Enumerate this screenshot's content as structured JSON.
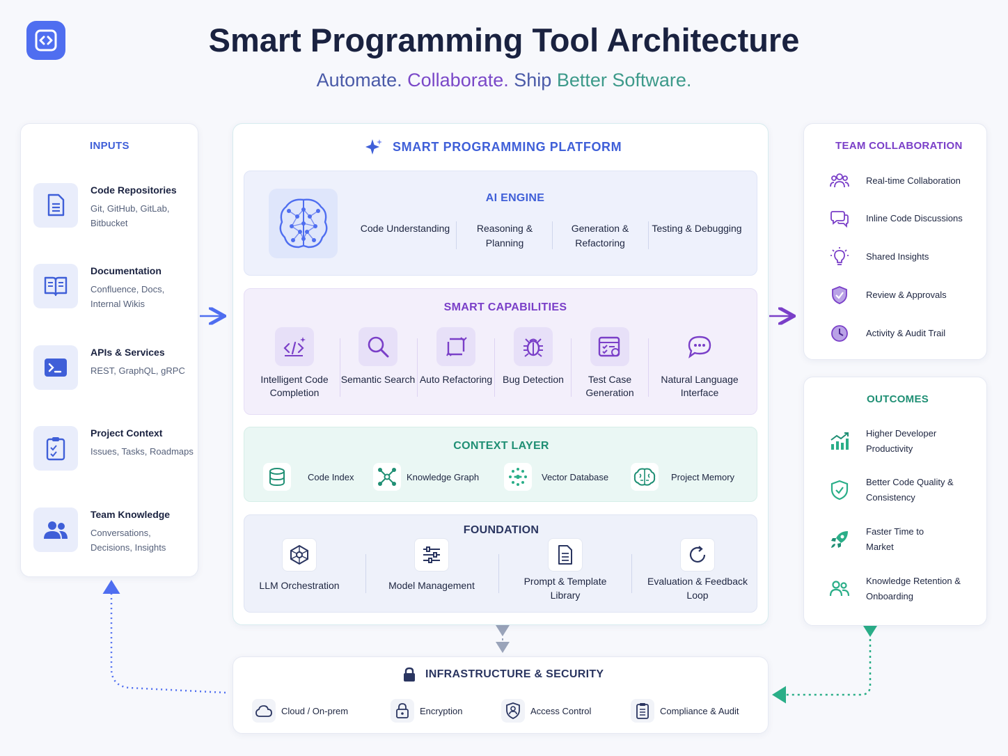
{
  "header": {
    "title": "Smart Programming Tool Architecture",
    "subtitle_1": "Automate.",
    "subtitle_2": "Collaborate.",
    "subtitle_3": "Ship",
    "subtitle_4": "Better Software."
  },
  "inputs": {
    "title": "INPUTS",
    "items": [
      {
        "name": "Code Repositories",
        "desc": "Git, GitHub, GitLab, Bitbucket",
        "icon": "document-icon"
      },
      {
        "name": "Documentation",
        "desc": "Confluence, Docs, Internal Wikis",
        "icon": "book-icon"
      },
      {
        "name": "APIs & Services",
        "desc": "REST, GraphQL, gRPC",
        "icon": "terminal-icon"
      },
      {
        "name": "Project Context",
        "desc": "Issues, Tasks, Roadmaps",
        "icon": "clipboard-icon"
      },
      {
        "name": "Team Knowledge",
        "desc": "Conversations, Decisions, Insights",
        "icon": "users-icon"
      }
    ]
  },
  "platform": {
    "title": "SMART PROGRAMMING PLATFORM",
    "ai_engine": {
      "title": "AI ENGINE",
      "items": [
        "Code Understanding",
        "Reasoning & Planning",
        "Generation & Refactoring",
        "Testing & Debugging"
      ]
    },
    "capabilities": {
      "title": "SMART CAPABILITIES",
      "items": [
        {
          "label": "Intelligent Code Completion",
          "icon": "code-sparkle-icon"
        },
        {
          "label": "Semantic Search",
          "icon": "search-icon"
        },
        {
          "label": "Auto Refactoring",
          "icon": "refactor-icon"
        },
        {
          "label": "Bug Detection",
          "icon": "bug-icon"
        },
        {
          "label": "Test Case Generation",
          "icon": "test-window-icon"
        },
        {
          "label": "Natural Language Interface",
          "icon": "chat-icon"
        }
      ]
    },
    "context": {
      "title": "CONTEXT LAYER",
      "items": [
        {
          "label": "Code Index",
          "icon": "database-icon"
        },
        {
          "label": "Knowledge Graph",
          "icon": "graph-icon"
        },
        {
          "label": "Vector Database",
          "icon": "vector-icon"
        },
        {
          "label": "Project Memory",
          "icon": "brain-icon"
        }
      ]
    },
    "foundation": {
      "title": "FOUNDATION",
      "items": [
        {
          "label": "LLM Orchestration",
          "icon": "network-icon"
        },
        {
          "label": "Model Management",
          "icon": "sliders-icon"
        },
        {
          "label": "Prompt & Template Library",
          "icon": "file-icon"
        },
        {
          "label": "Evaluation & Feedback Loop",
          "icon": "refresh-icon"
        }
      ]
    }
  },
  "team": {
    "title": "TEAM COLLABORATION",
    "items": [
      {
        "label": "Real-time Collaboration",
        "icon": "people-icon"
      },
      {
        "label": "Inline Code Discussions",
        "icon": "comments-icon"
      },
      {
        "label": "Shared Insights",
        "icon": "lightbulb-icon"
      },
      {
        "label": "Review & Approvals",
        "icon": "shield-check-icon"
      },
      {
        "label": "Activity & Audit Trail",
        "icon": "clock-icon"
      }
    ]
  },
  "outcomes": {
    "title": "OUTCOMES",
    "items": [
      {
        "label": "Higher Developer Productivity",
        "icon": "growth-chart-icon"
      },
      {
        "label": "Better Code Quality & Consistency",
        "icon": "shield-check-icon"
      },
      {
        "label": "Faster Time to Market",
        "icon": "rocket-icon"
      },
      {
        "label": "Knowledge Retention & Onboarding",
        "icon": "people-icon"
      }
    ]
  },
  "infra": {
    "title": "INFRASTRUCTURE & SECURITY",
    "items": [
      {
        "label": "Cloud / On-prem",
        "icon": "cloud-icon"
      },
      {
        "label": "Encryption",
        "icon": "lock-icon"
      },
      {
        "label": "Access Control",
        "icon": "user-shield-icon"
      },
      {
        "label": "Compliance & Audit",
        "icon": "clipboard-icon"
      }
    ]
  },
  "colors": {
    "blue": "#3f5fd8",
    "purple": "#7a3fc8",
    "teal": "#2a9c80",
    "navy": "#1a2240"
  }
}
